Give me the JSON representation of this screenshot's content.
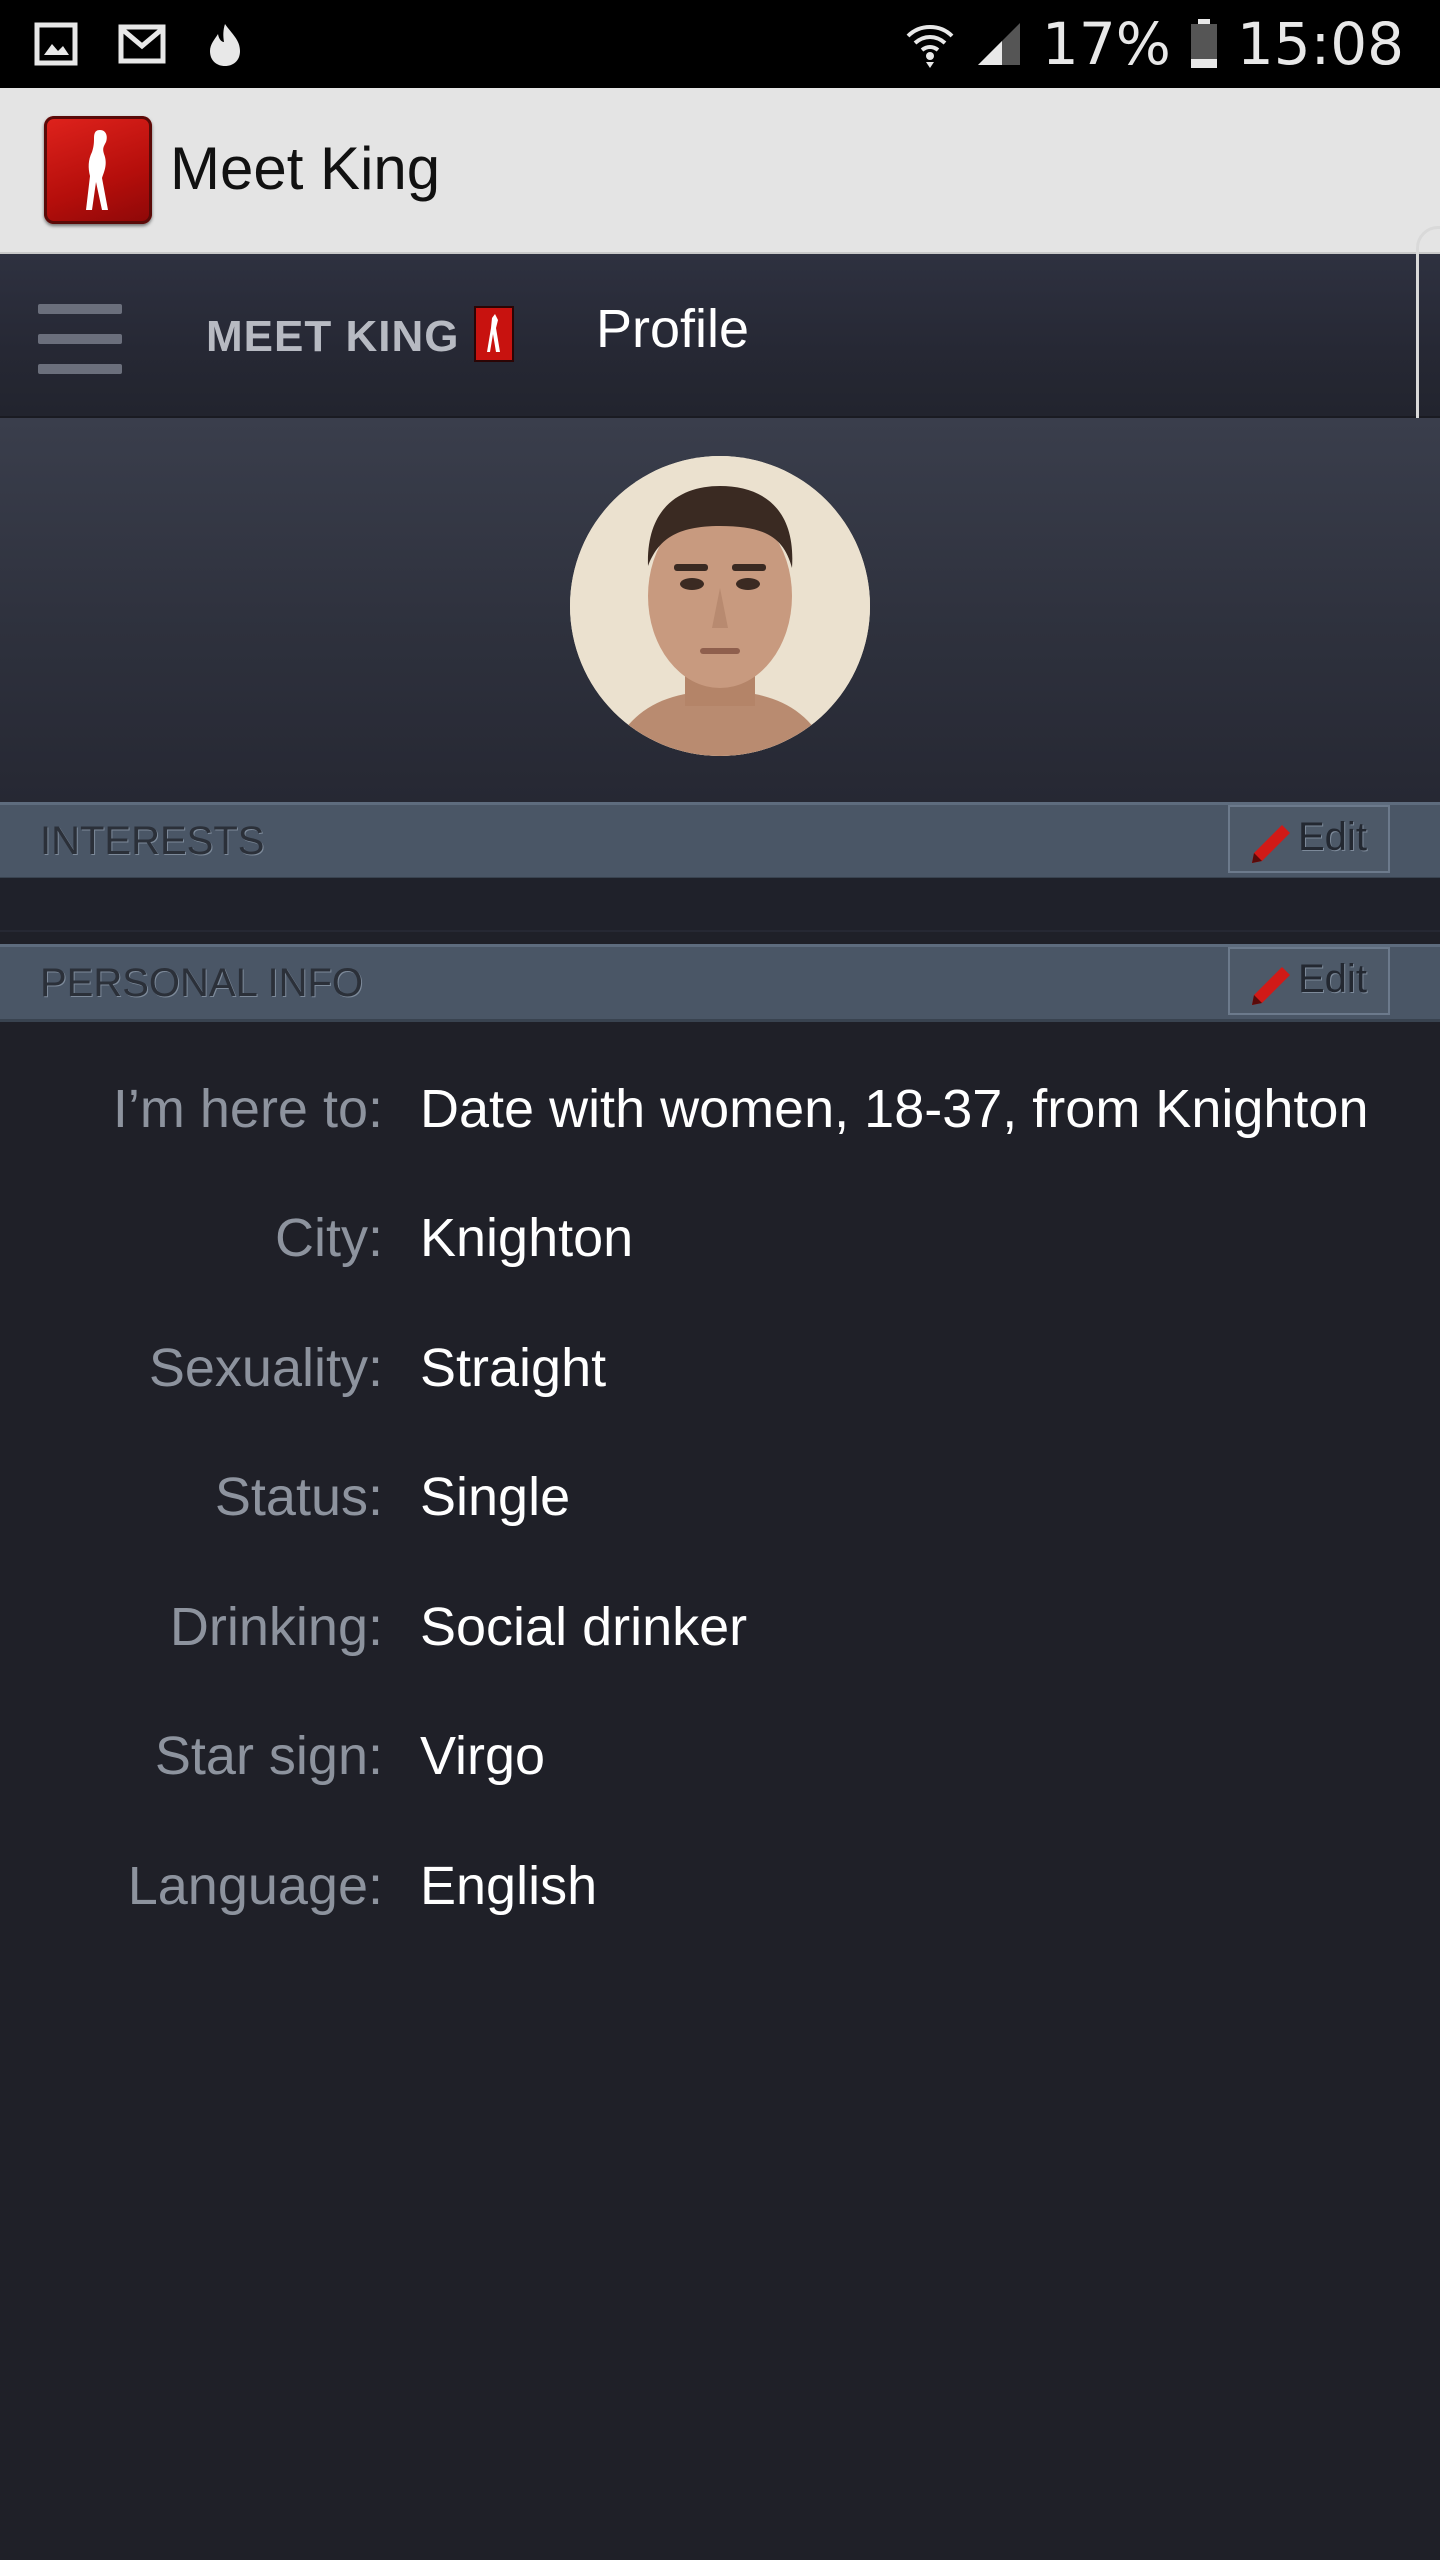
{
  "status_bar": {
    "battery": "17%",
    "time": "15:08",
    "icons": [
      "gallery-icon",
      "gmail-icon",
      "fire-icon",
      "wifi-icon",
      "signal-icon",
      "battery-icon"
    ]
  },
  "app_bar": {
    "title": "Meet King"
  },
  "header": {
    "brand": "MEET KING",
    "page_title": "Profile"
  },
  "sections": {
    "interests": {
      "title": "INTERESTS",
      "edit_label": "Edit"
    },
    "personal_info": {
      "title": "PERSONAL INFO",
      "edit_label": "Edit"
    }
  },
  "personal_info": [
    {
      "label": "I’m here to:",
      "value": "Date with women, 18-37, from Knighton"
    },
    {
      "label": "City:",
      "value": "Knighton"
    },
    {
      "label": "Sexuality:",
      "value": "Straight"
    },
    {
      "label": "Status:",
      "value": "Single"
    },
    {
      "label": "Drinking:",
      "value": "Social drinker"
    },
    {
      "label": "Star sign:",
      "value": "Virgo"
    },
    {
      "label": "Language:",
      "value": "English"
    }
  ],
  "colors": {
    "accent_red": "#c8120f",
    "section_header": "#4a5666",
    "background": "#1f2028"
  }
}
